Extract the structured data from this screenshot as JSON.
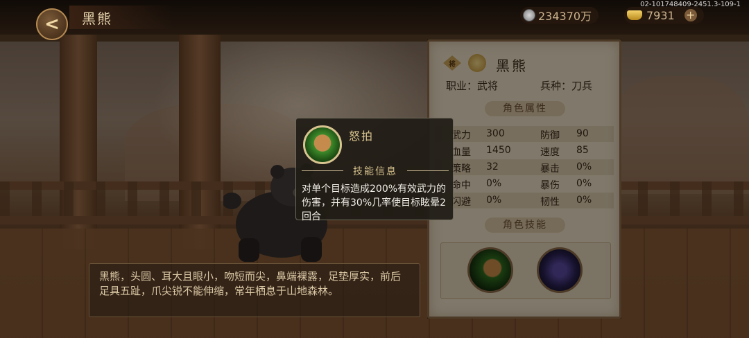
{
  "header": {
    "title": "黑熊",
    "currency_silver": "234370万",
    "currency_gold": "7931",
    "plus_label": "+",
    "build_id": "02-101748409-2451.3-109-1"
  },
  "description": "黑熊，头圆、耳大且眼小，吻短而尖，鼻端裸露，足垫厚实，前后足具五趾，爪尖锐不能伸缩，常年栖息于山地森林。",
  "panel": {
    "name": "黑熊",
    "job": "职业：武将",
    "troop": "兵种：刀兵",
    "attributes_title": "角色属性",
    "skills_title": "角色技能",
    "stats": [
      {
        "k1": "武力",
        "v1": "300",
        "k2": "防御",
        "v2": "90"
      },
      {
        "k1": "血量",
        "v1": "1450",
        "k2": "速度",
        "v2": "85"
      },
      {
        "k1": "策略",
        "v1": "32",
        "k2": "暴击",
        "v2": "0%"
      },
      {
        "k1": "命中",
        "v1": "0%",
        "k2": "暴伤",
        "v2": "0%"
      },
      {
        "k1": "闪避",
        "v1": "0%",
        "k2": "韧性",
        "v2": "0%"
      }
    ]
  },
  "tooltip": {
    "skill_name": "怒拍",
    "section_label": "技能信息",
    "description": "对单个目标造成200%有效武力的伤害，并有30%几率使目标眩晕2回合"
  },
  "colors": {
    "panel_bg": "#e9dcc3",
    "tooltip_bg": "#201c16",
    "accent_gold": "#d8c38e"
  }
}
